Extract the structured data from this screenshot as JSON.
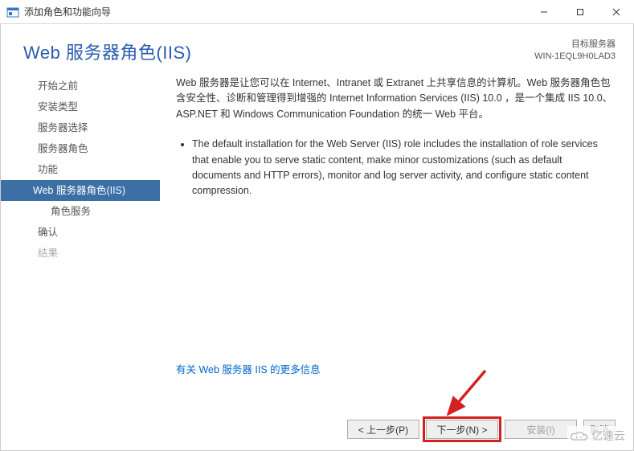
{
  "window": {
    "title": "添加角色和功能向导"
  },
  "header": {
    "page_title": "Web 服务器角色(IIS)",
    "target_label": "目标服务器",
    "target_value": "WIN-1EQL9H0LAD3"
  },
  "nav": {
    "items": [
      {
        "label": "开始之前",
        "selected": false,
        "level": 1
      },
      {
        "label": "安装类型",
        "selected": false,
        "level": 1
      },
      {
        "label": "服务器选择",
        "selected": false,
        "level": 1
      },
      {
        "label": "服务器角色",
        "selected": false,
        "level": 1
      },
      {
        "label": "功能",
        "selected": false,
        "level": 1
      },
      {
        "label": "Web 服务器角色(IIS)",
        "selected": true,
        "level": 1
      },
      {
        "label": "角色服务",
        "selected": false,
        "level": 2
      },
      {
        "label": "确认",
        "selected": false,
        "level": 1
      },
      {
        "label": "结果",
        "selected": false,
        "level": 1,
        "disabled": true
      }
    ]
  },
  "content": {
    "intro": "Web 服务器是让您可以在 Internet、Intranet 或 Extranet 上共享信息的计算机。Web 服务器角色包含安全性、诊断和管理得到增强的 Internet Information Services (IIS) 10.0 ，是一个集成 IIS 10.0、ASP.NET 和 Windows Communication Foundation 的统一 Web 平台。",
    "bullets": [
      "The default installation for the Web Server (IIS) role includes the installation of role services that enable you to serve static content, make minor customizations (such as default documents and HTTP errors), monitor and log server activity, and configure static content compression."
    ],
    "more_link": "有关 Web 服务器 IIS 的更多信息"
  },
  "footer": {
    "previous": "< 上一步(P)",
    "next": "下一步(N) >",
    "install": "安装(I)",
    "cancel": "取消"
  },
  "watermark": {
    "text": "亿速云"
  }
}
